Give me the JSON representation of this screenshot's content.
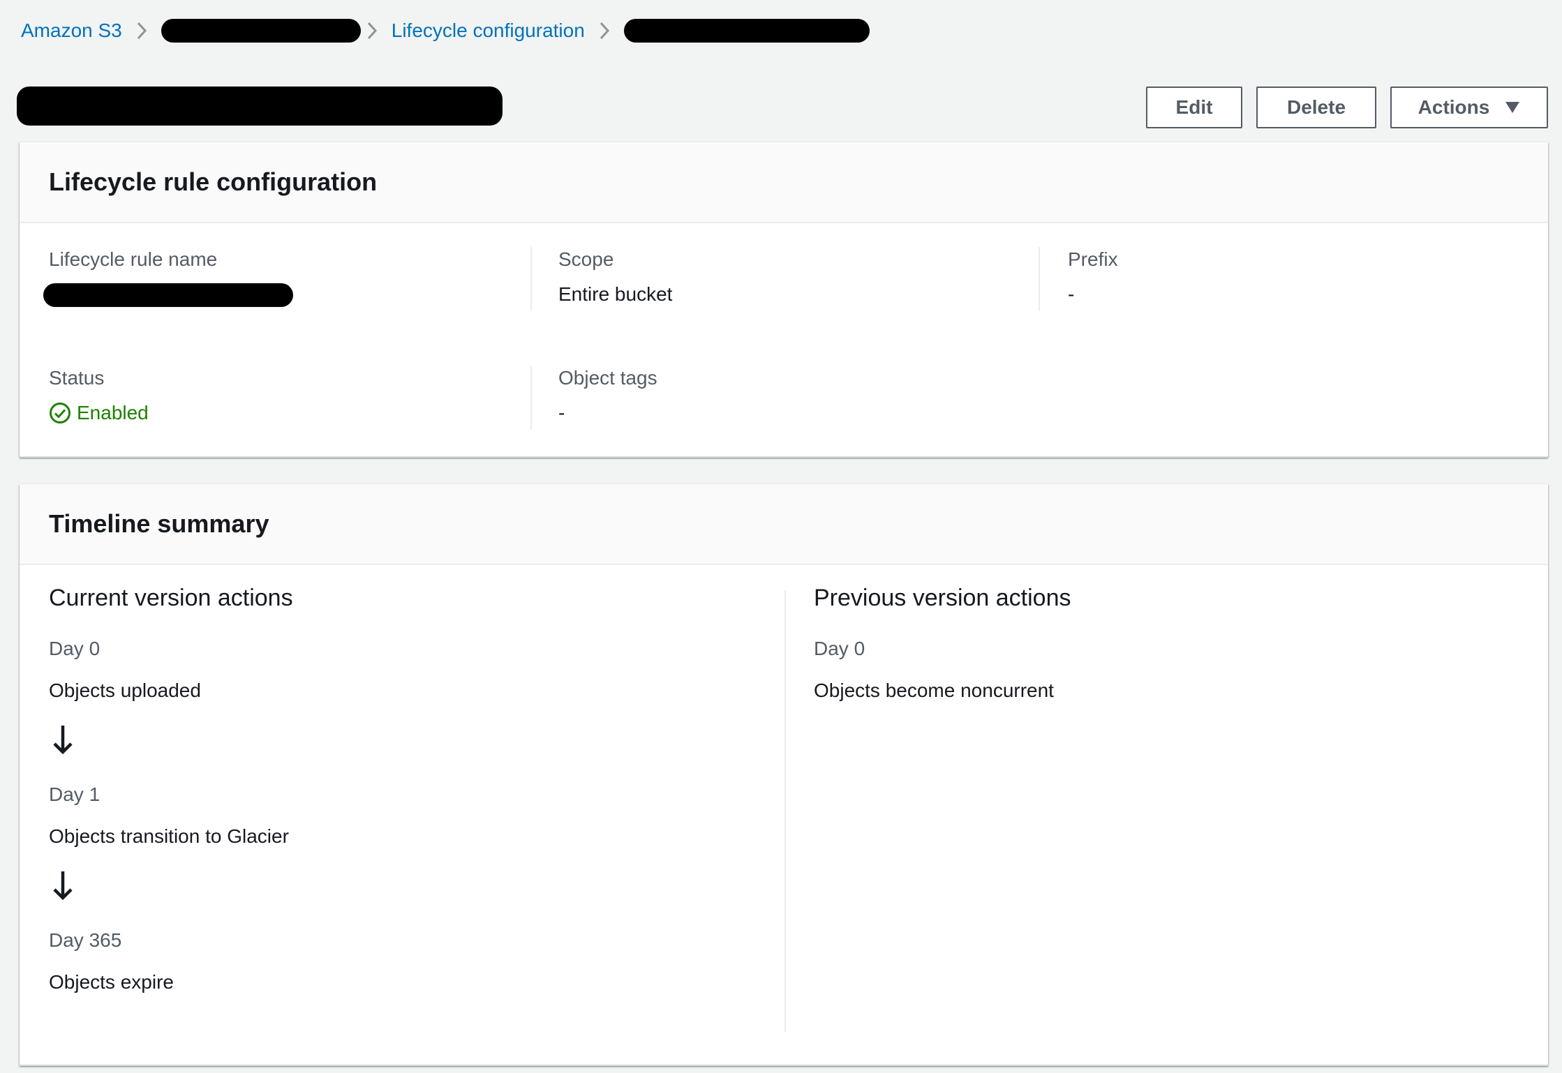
{
  "breadcrumb": {
    "root": "Amazon S3",
    "lifecycle": "Lifecycle configuration"
  },
  "header": {
    "buttons": {
      "edit": "Edit",
      "delete": "Delete",
      "actions": "Actions"
    }
  },
  "config_panel": {
    "title": "Lifecycle rule configuration",
    "rule_name_label": "Lifecycle rule name",
    "scope_label": "Scope",
    "scope_value": "Entire bucket",
    "prefix_label": "Prefix",
    "prefix_value": "-",
    "status_label": "Status",
    "status_value": "Enabled",
    "object_tags_label": "Object tags",
    "object_tags_value": "-"
  },
  "timeline_panel": {
    "title": "Timeline summary",
    "current": {
      "heading": "Current version actions",
      "steps": [
        {
          "day": "Day 0",
          "text": "Objects uploaded"
        },
        {
          "day": "Day 1",
          "text": "Objects transition to Glacier"
        },
        {
          "day": "Day 365",
          "text": "Objects expire"
        }
      ]
    },
    "previous": {
      "heading": "Previous version actions",
      "steps": [
        {
          "day": "Day 0",
          "text": "Objects become noncurrent"
        }
      ]
    }
  },
  "colors": {
    "link": "#0073bb",
    "success": "#1d8102",
    "background": "#f2f3f3"
  },
  "icons": [
    "chevron-right-icon",
    "caret-down-icon",
    "status-success-icon",
    "arrow-down-icon"
  ]
}
